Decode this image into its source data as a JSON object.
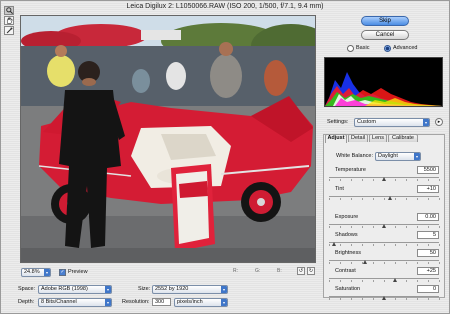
{
  "window": {
    "title": "Leica Digilux 2:  L1050066.RAW  (ISO 200, 1/500, f/7.1, 9.4 mm)"
  },
  "tools": [
    {
      "name": "zoom-tool-icon",
      "glyph": "🔍"
    },
    {
      "name": "hand-tool-icon",
      "glyph": "✋"
    },
    {
      "name": "eyedropper-tool-icon",
      "glyph": "✎"
    }
  ],
  "buttons": {
    "skip": "Skip",
    "cancel": "Cancel"
  },
  "view_mode": {
    "basic": "Basic",
    "advanced": "Advanced",
    "selected": "advanced"
  },
  "colors": {
    "accent": "#4b8de4",
    "car_red": "#d41c34"
  },
  "preview": {
    "zoom": "24.8%",
    "preview_label": "Preview",
    "r_label": "R:",
    "g_label": "G:",
    "b_label": "B:"
  },
  "output": {
    "space_label": "Space:",
    "space_value": "Adobe RGB (1998)",
    "size_label": "Size:",
    "size_value": "2552 by 1920",
    "depth_label": "Depth:",
    "depth_value": "8 Bits/Channel",
    "resolution_label": "Resolution:",
    "resolution_value": "300",
    "resolution_unit": "pixels/inch"
  },
  "settings": {
    "label": "Settings:",
    "value": "Custom",
    "menu_icon": "triangle-menu-icon"
  },
  "tabs": [
    {
      "label": "Adjust",
      "active": true
    },
    {
      "label": "Detail",
      "active": false
    },
    {
      "label": "Lens",
      "active": false
    },
    {
      "label": "Calibrate",
      "active": false
    }
  ],
  "adjust": {
    "white_balance_label": "White Balance:",
    "white_balance_value": "Daylight",
    "sliders": [
      {
        "label": "Temperature",
        "value": "5500",
        "level": 0.5
      },
      {
        "label": "Tint",
        "value": "+10",
        "level": 0.56
      },
      {
        "label": "Exposure",
        "value": "0.00",
        "level": 0.5
      },
      {
        "label": "Shadows",
        "value": "5",
        "level": 0.05
      },
      {
        "label": "Brightness",
        "value": "50",
        "level": 0.33
      },
      {
        "label": "Contrast",
        "value": "+25",
        "level": 0.6
      },
      {
        "label": "Saturation",
        "value": "0",
        "level": 0.5
      }
    ]
  }
}
